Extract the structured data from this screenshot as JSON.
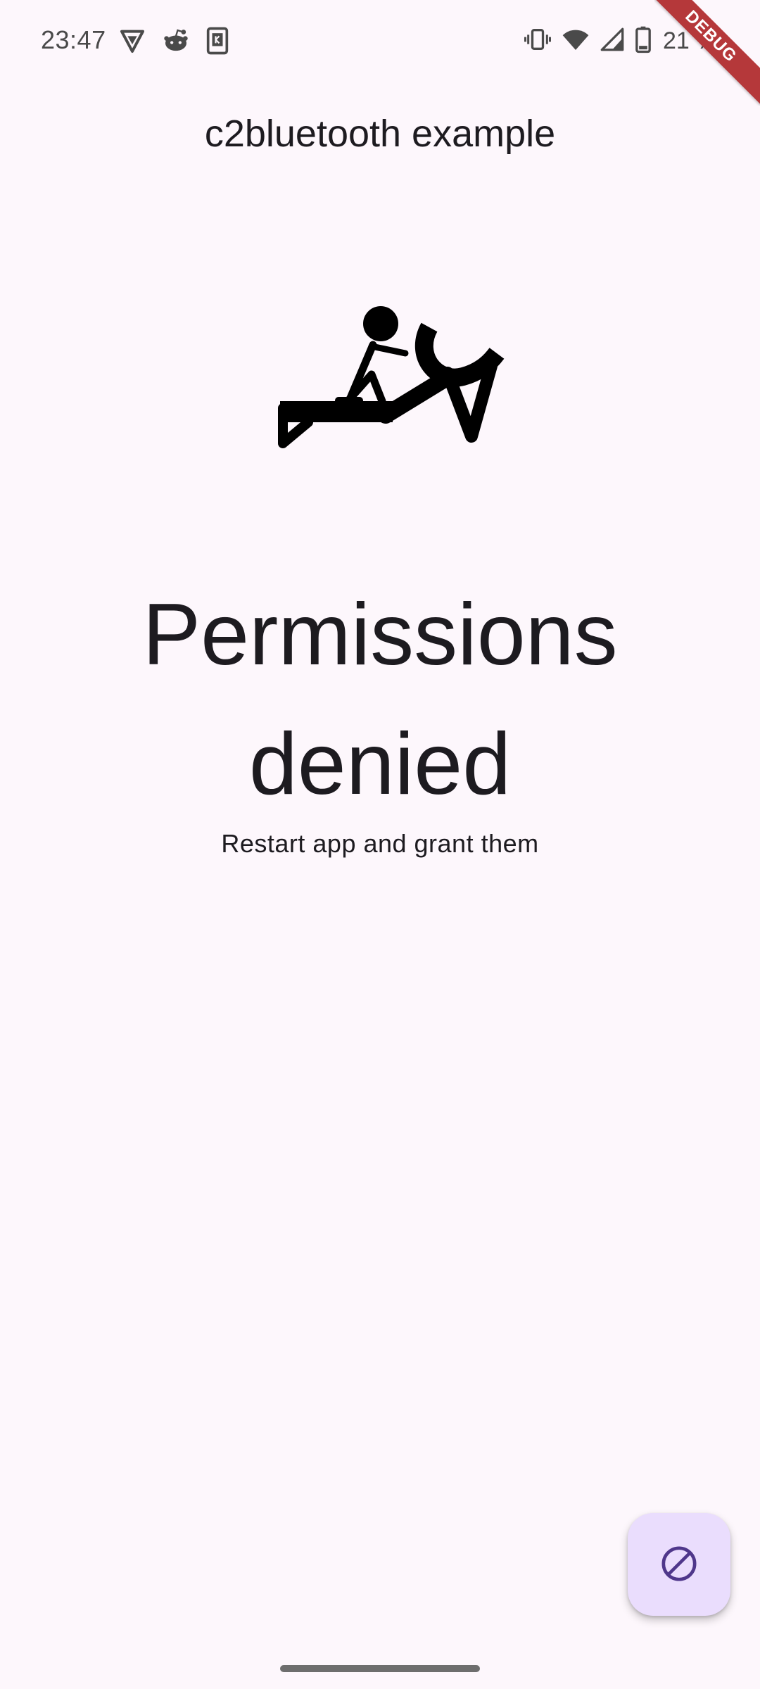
{
  "status_bar": {
    "time": "23:47",
    "battery_percent": "21 %",
    "left_icons": [
      "vpn-shield-icon",
      "reddit-icon",
      "kindle-icon"
    ],
    "right_icons": [
      "vibrate-icon",
      "wifi-icon",
      "cell-signal-icon",
      "battery-icon"
    ]
  },
  "debug_banner": {
    "label": "DEBUG",
    "color": "#b5383a"
  },
  "app_bar": {
    "title": "c2bluetooth example"
  },
  "content": {
    "hero_icon": "rowing-machine-icon",
    "title": "Permissions denied",
    "subtitle": "Restart app and grant them"
  },
  "fab": {
    "icon": "block-icon",
    "background": "#eaddfd",
    "icon_color": "#4f378b"
  },
  "theme": {
    "background": "#fdf7fc",
    "text": "#1d1b20"
  }
}
